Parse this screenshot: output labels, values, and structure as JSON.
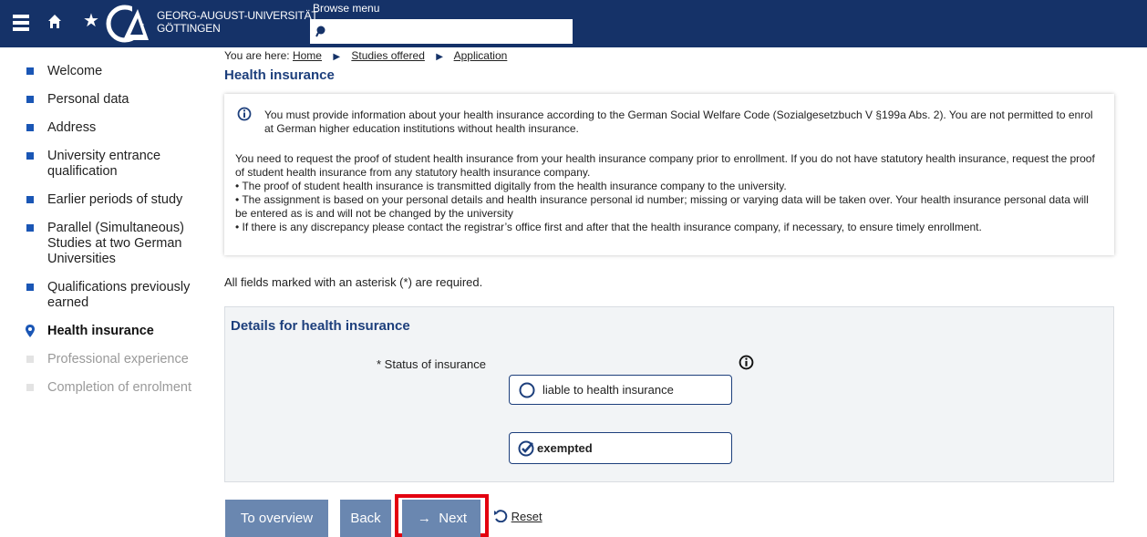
{
  "header": {
    "university_line1": "GEORG-AUGUST-UNIVERSITÄT",
    "university_line2": "GÖTTINGEN",
    "browse_label": "Browse menu",
    "brand_color": "#153268"
  },
  "sidebar": {
    "items": [
      {
        "label": "Welcome",
        "state": "done"
      },
      {
        "label": "Personal data",
        "state": "done"
      },
      {
        "label": "Address",
        "state": "done"
      },
      {
        "label": "University entrance qualification",
        "state": "done"
      },
      {
        "label": "Earlier periods of study",
        "state": "done"
      },
      {
        "label": "Parallel (Simultaneous) Studies at two German Universities",
        "state": "done"
      },
      {
        "label": "Qualifications previously earned",
        "state": "done"
      },
      {
        "label": "Health insurance",
        "state": "active"
      },
      {
        "label": "Professional experience",
        "state": "disabled"
      },
      {
        "label": "Completion of enrolment",
        "state": "disabled"
      }
    ]
  },
  "breadcrumb": {
    "prefix": "You are here:",
    "items": [
      "Home",
      "Studies offered",
      "Application"
    ]
  },
  "page_title": "Health insurance",
  "info": {
    "first": "You must provide information about your health insurance according to the German Social Welfare Code (Sozialgesetzbuch V §199a Abs. 2). You are not permitted to enrol at German higher education institutions without health insurance.",
    "para": "You need to request the proof of student health insurance from your health insurance company prior to enrollment. If you do not have statutory health insurance, request the proof of student health insurance from any statutory health insurance company.",
    "bullet1": "• The proof of student health insurance is transmitted digitally from the health insurance company to the university.",
    "bullet2": "• The assignment is based on your personal details and health insurance personal id number; missing or varying data will be taken over. Your health insurance personal data will be entered as is and will not be changed by the university",
    "bullet3": "• If there is any discrepancy please contact the registrar’s office first and after that the health insurance company, if necessary, to ensure timely enrollment."
  },
  "required_note": "All fields marked with an asterisk (*) are required.",
  "form": {
    "section_title": "Details for health insurance",
    "status_label": "* Status of insurance",
    "options": [
      {
        "label": "liable to health insurance",
        "selected": false
      },
      {
        "label": "exempted",
        "selected": true
      }
    ]
  },
  "buttons": {
    "overview": "To overview",
    "back": "Back",
    "next": "Next",
    "reset": "Reset",
    "highlight_color": "#e3000f"
  }
}
